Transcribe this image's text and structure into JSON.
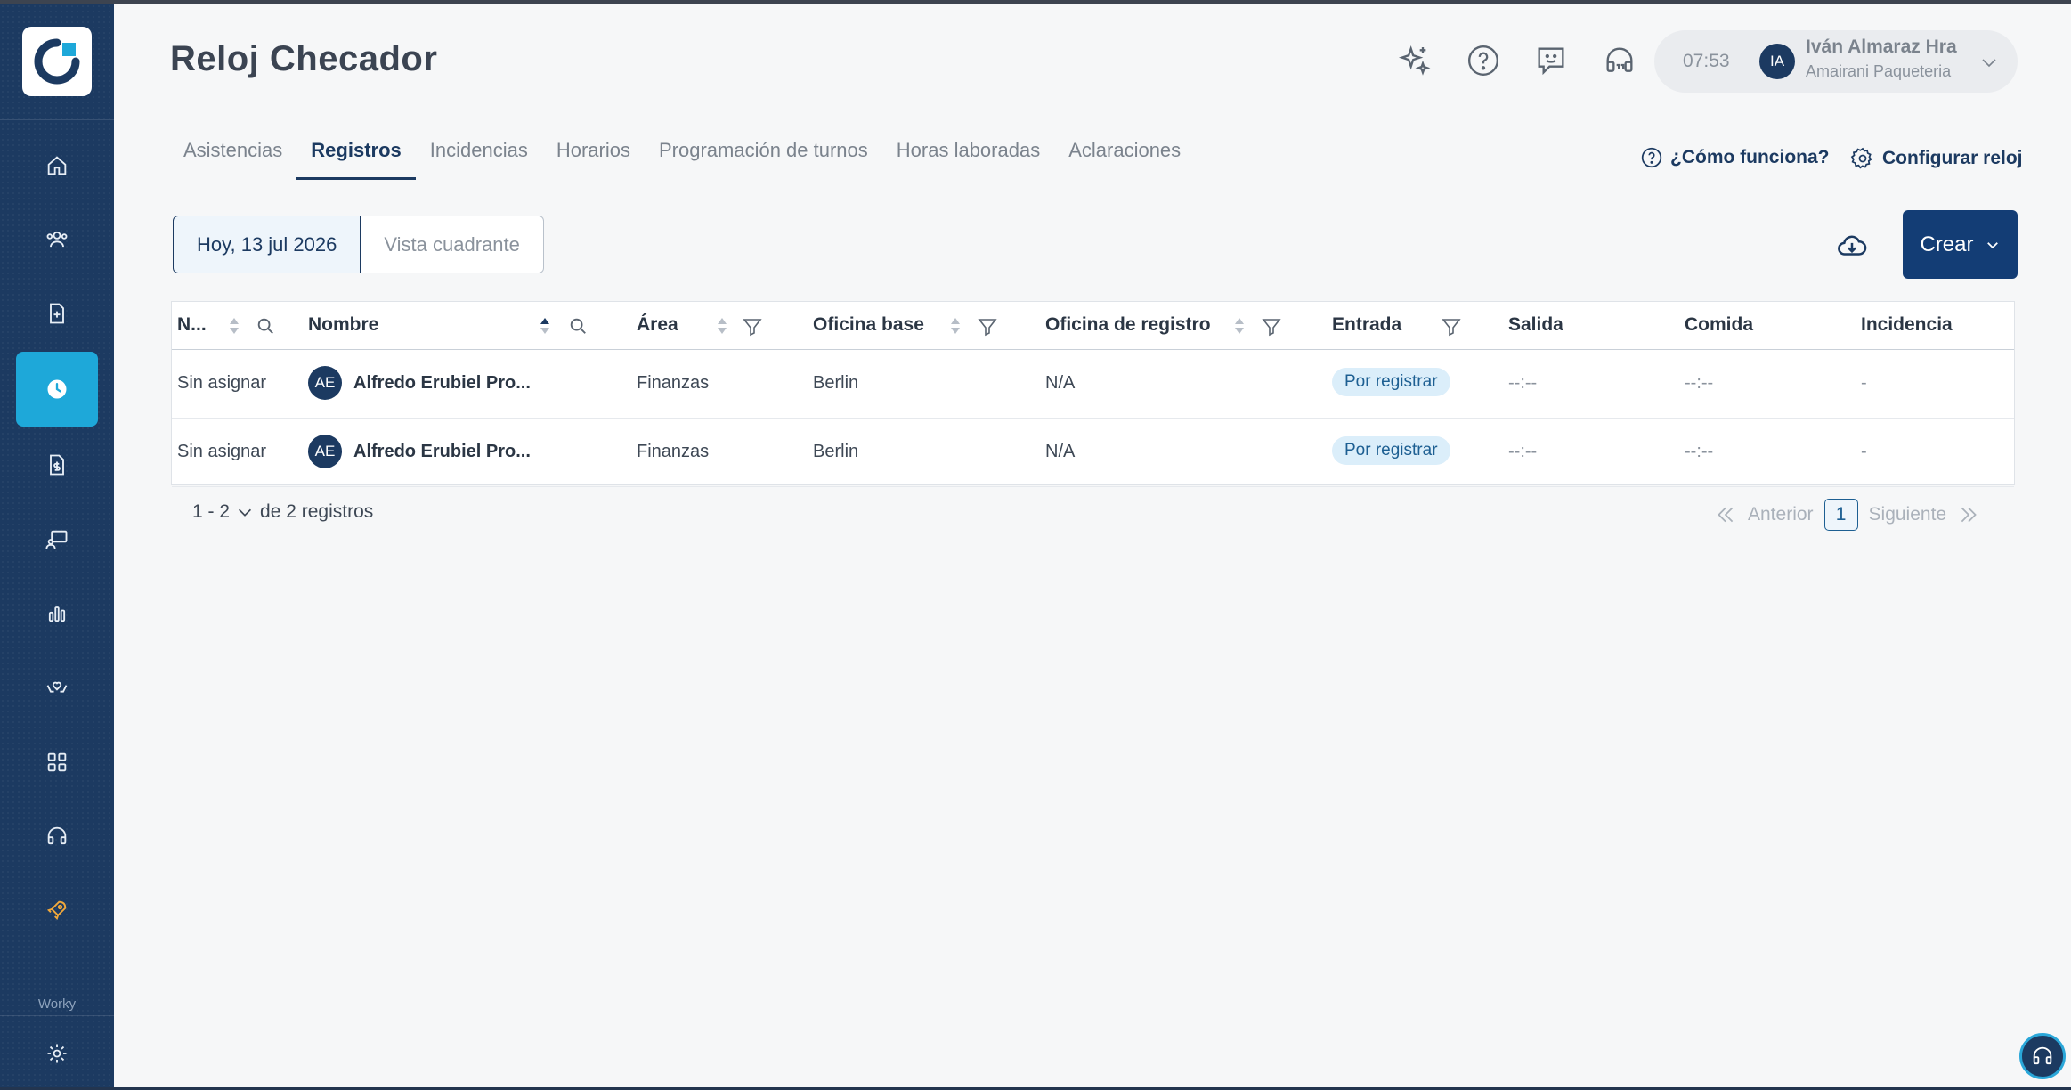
{
  "app": {
    "page_title": "Reloj Checador",
    "brand_label": "Worky"
  },
  "colors": {
    "sidebar_bg": "#1c3a61",
    "active_nav": "#1ea8d9",
    "primary_button": "#133d75",
    "badge_bg": "#dbeefa",
    "badge_text": "#1d5f92"
  },
  "sidebar": {
    "items": [
      {
        "icon": "home-icon"
      },
      {
        "icon": "people-icon"
      },
      {
        "icon": "document-plus-icon"
      },
      {
        "icon": "clock-icon",
        "active": true
      },
      {
        "icon": "payroll-document-icon"
      },
      {
        "icon": "training-icon"
      },
      {
        "icon": "bar-chart-icon"
      },
      {
        "icon": "hands-heart-icon"
      },
      {
        "icon": "apps-grid-icon"
      },
      {
        "icon": "headset-icon"
      },
      {
        "icon": "rocket-icon"
      }
    ],
    "settings_icon": "gear-icon"
  },
  "header": {
    "icons": [
      "sparkles-icon",
      "help-circle-icon",
      "feedback-chat-icon",
      "support-headset-icon"
    ],
    "time": "07:53",
    "user_initials": "IA",
    "user_name": "Iván Almaraz Hra",
    "user_company": "Amairani Paqueteria"
  },
  "tabs": [
    {
      "label": "Asistencias",
      "active": false
    },
    {
      "label": "Registros",
      "active": true
    },
    {
      "label": "Incidencias",
      "active": false
    },
    {
      "label": "Horarios",
      "active": false
    },
    {
      "label": "Programación de turnos",
      "active": false
    },
    {
      "label": "Horas laboradas",
      "active": false
    },
    {
      "label": "Aclaraciones",
      "active": false
    }
  ],
  "links": {
    "help": "¿Cómo funciona?",
    "configure": "Configurar reloj"
  },
  "toolbar": {
    "date_button": "Hoy, 13 jul 2026",
    "grid_view_button": "Vista cuadrante",
    "create_button": "Crear"
  },
  "table": {
    "columns": [
      "N...",
      "Nombre",
      "Área",
      "Oficina base",
      "Oficina de registro",
      "Entrada",
      "Salida",
      "Comida",
      "Incidencia"
    ],
    "rows": [
      {
        "number": "Sin asignar",
        "initials": "AE",
        "name": "Alfredo Erubiel Pro...",
        "area": "Finanzas",
        "office": "Berlin",
        "registry_office": "N/A",
        "entry": "Por registrar",
        "exit": "--:--",
        "meal": "--:--",
        "incident": "-"
      },
      {
        "number": "Sin asignar",
        "initials": "AE",
        "name": "Alfredo Erubiel Pro...",
        "area": "Finanzas",
        "office": "Berlin",
        "registry_office": "N/A",
        "entry": "Por registrar",
        "exit": "--:--",
        "meal": "--:--",
        "incident": "-"
      }
    ]
  },
  "pagination": {
    "range": "1 - 2",
    "total_text": "de 2 registros",
    "previous": "Anterior",
    "current_page": "1",
    "next": "Siguiente"
  }
}
